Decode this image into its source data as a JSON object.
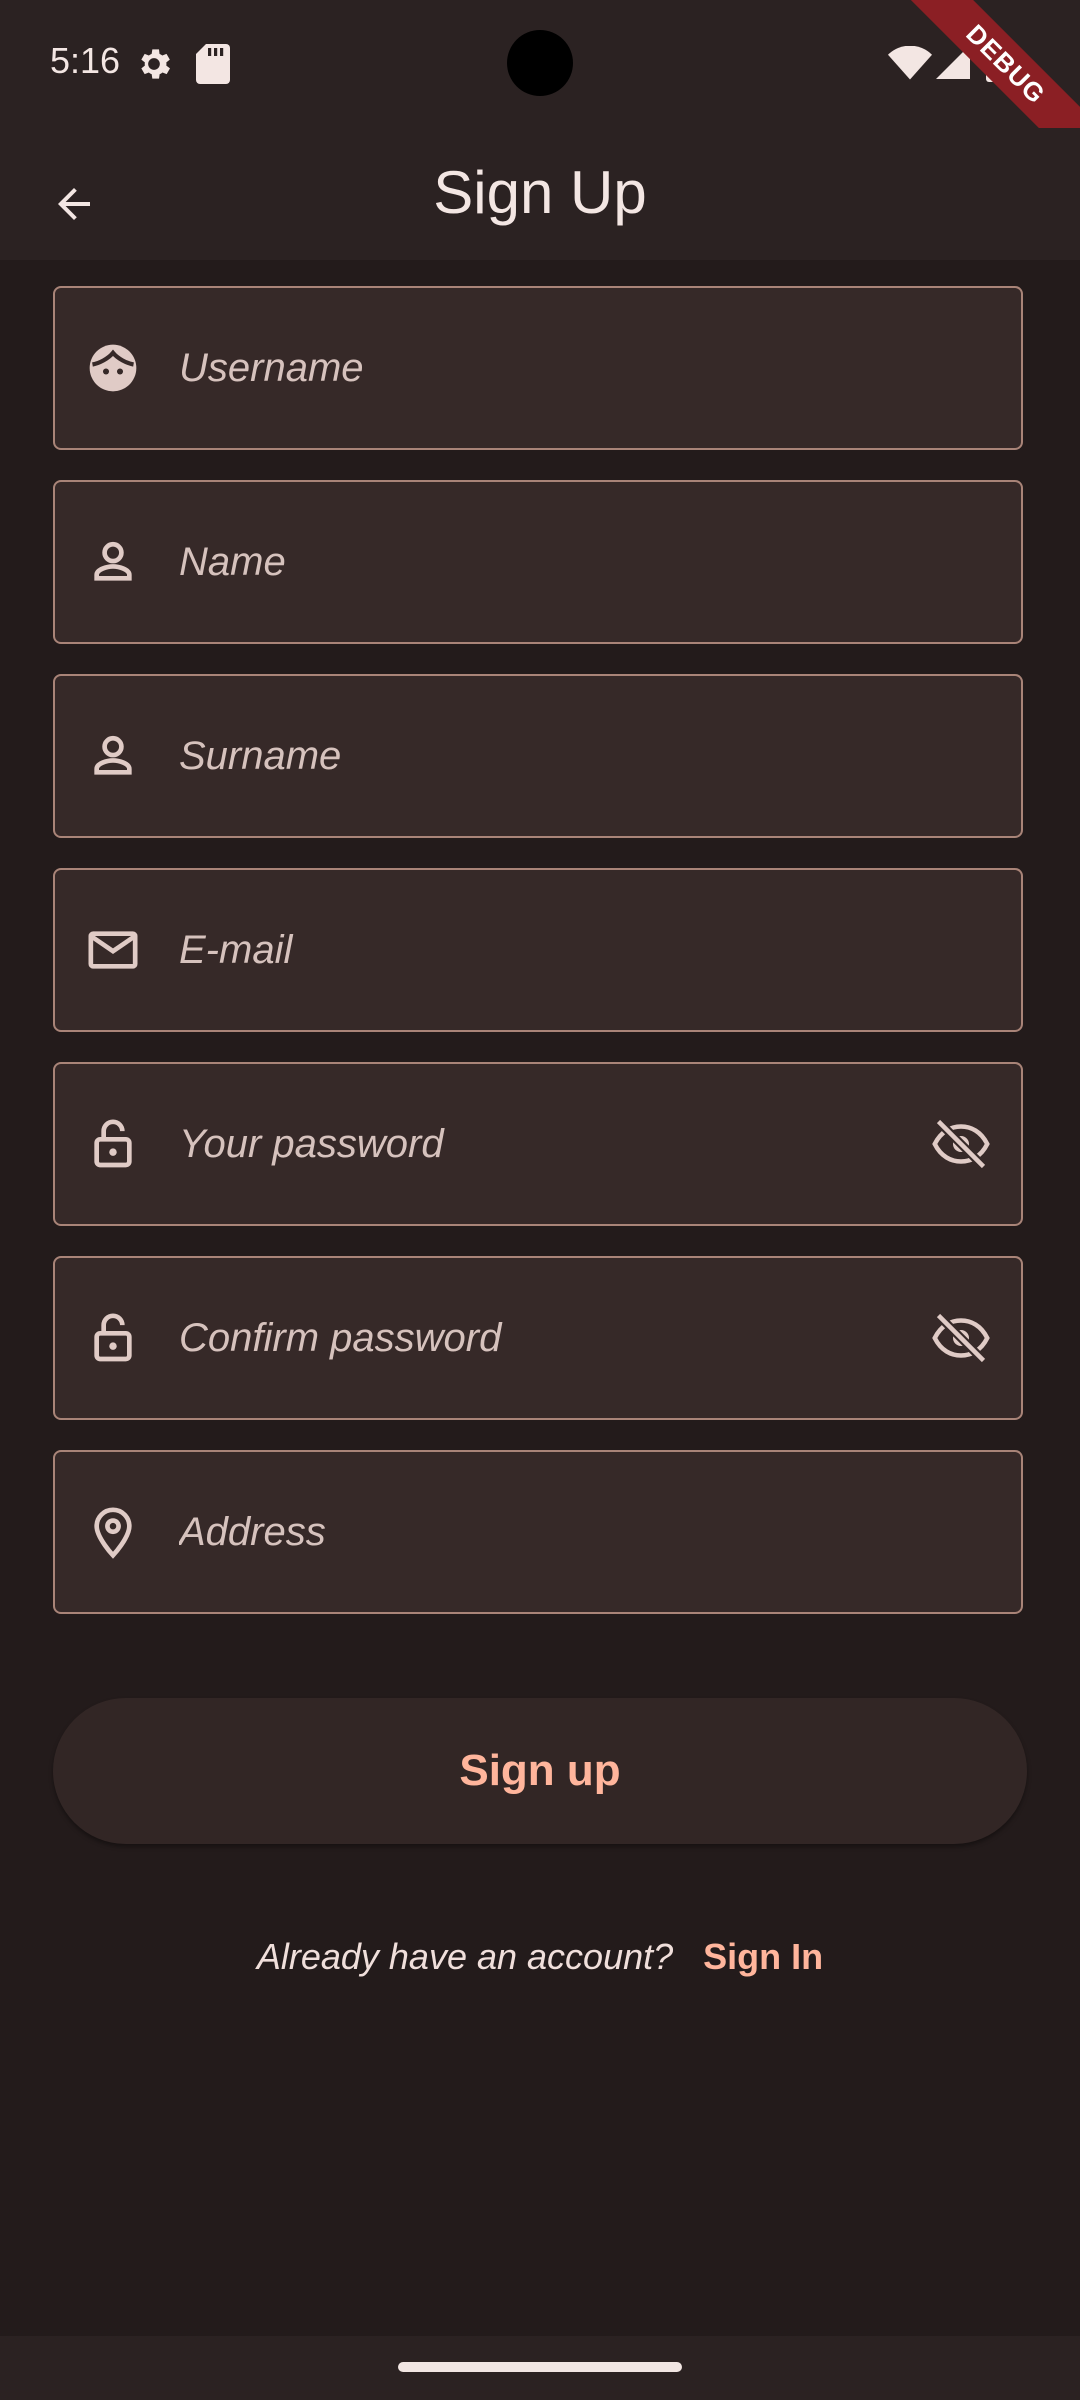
{
  "status_bar": {
    "time": "5:16"
  },
  "debug_banner": "DEBUG",
  "app_bar": {
    "title": "Sign Up"
  },
  "form": {
    "username_placeholder": "Username",
    "name_placeholder": "Name",
    "surname_placeholder": "Surname",
    "email_placeholder": "E-mail",
    "password_placeholder": "Your password",
    "confirm_password_placeholder": "Confirm password",
    "address_placeholder": "Address"
  },
  "signup_button": "Sign up",
  "footer": {
    "question": "Already have an account?",
    "signin_link": "Sign In"
  },
  "colors": {
    "background": "#231b1b",
    "bar": "#2b2222",
    "field_fill": "#362928",
    "field_border": "#a98478",
    "accent": "#ffb59c",
    "debug": "#8b1f24"
  }
}
